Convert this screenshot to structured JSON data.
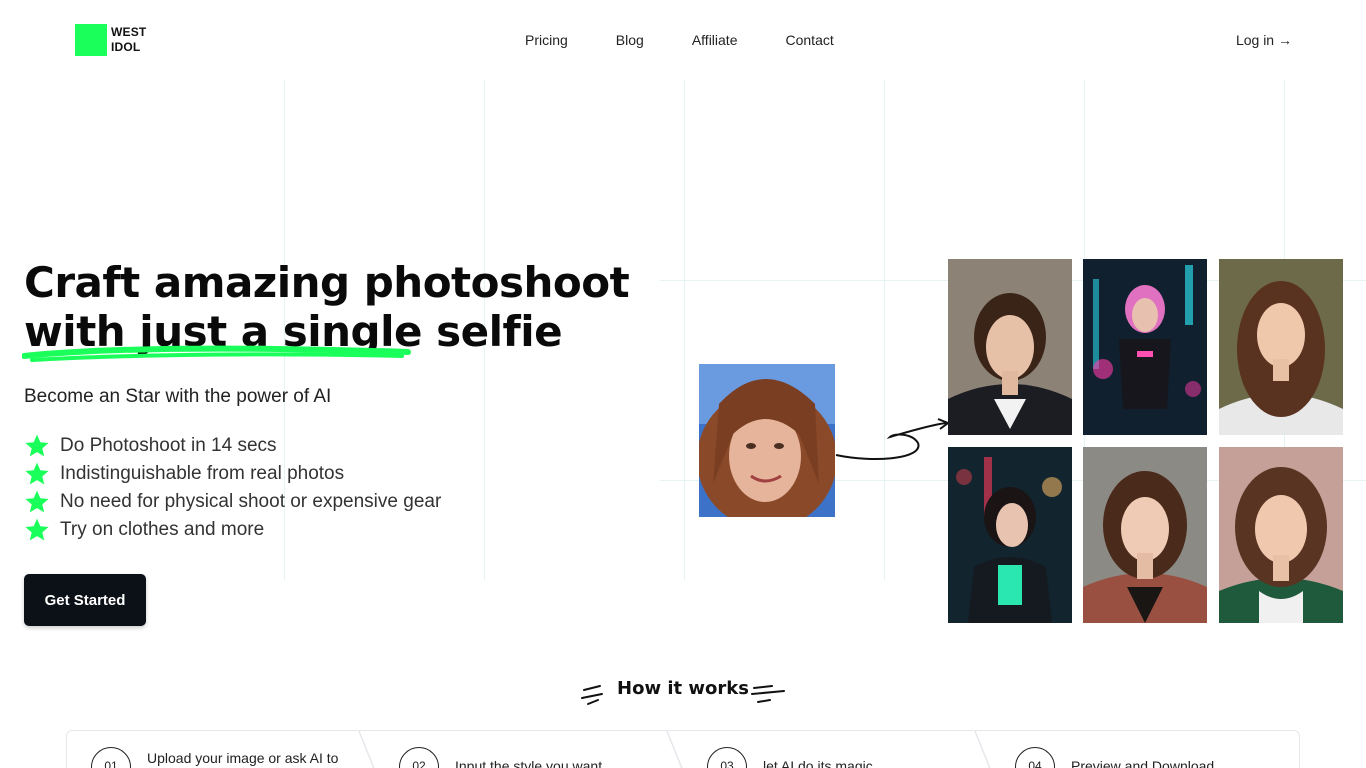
{
  "brand": {
    "name_line1": "WEST",
    "name_line2": "IDOL",
    "logo_color": "#1aff5a"
  },
  "nav": {
    "items": [
      "Pricing",
      "Blog",
      "Affiliate",
      "Contact"
    ],
    "login": "Log in →"
  },
  "hero": {
    "title_line1": "Craft amazing photoshoot",
    "title_line2": "with just a single selfie",
    "subtitle": "Become an Star with the power of AI",
    "features": [
      "Do Photoshoot in 14 secs",
      "Indistinguishable from real photos",
      "No need for physical shoot or expensive gear",
      "Try on clothes and more"
    ],
    "cta": "Get Started",
    "accent_color": "#1aff5a"
  },
  "how_it_works": {
    "title": "How it works",
    "steps": [
      {
        "num": "01",
        "label": "Upload your image or ask AI to"
      },
      {
        "num": "02",
        "label": "Input the style you want"
      },
      {
        "num": "03",
        "label": "let AI do its magic"
      },
      {
        "num": "04",
        "label": "Preview and Download"
      }
    ]
  }
}
